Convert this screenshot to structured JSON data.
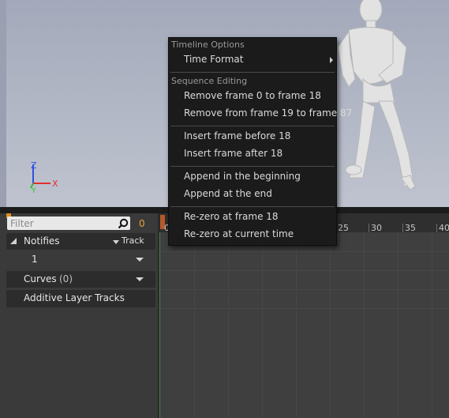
{
  "viewport": {
    "axis": {
      "z": "Z",
      "x": "X",
      "y": "Y"
    }
  },
  "timeline": {
    "filter_placeholder": "Filter",
    "frame_count": "0",
    "ruler_ticks": [
      "0",
      "25",
      "30",
      "35",
      "40"
    ],
    "notifies": {
      "label": "Notifies",
      "track_button": "Track",
      "track_index": "1"
    },
    "curves": {
      "label": "Curves",
      "count": "(0)"
    },
    "additive": {
      "label": "Additive Layer Tracks"
    }
  },
  "menu": {
    "section_timeline": "Timeline Options",
    "time_format": "Time Format",
    "section_sequence": "Sequence Editing",
    "remove_0_18": "Remove frame 0 to frame 18",
    "remove_19_87": "Remove from frame 19 to frame 87",
    "insert_before": "Insert frame before 18",
    "insert_after": "Insert frame after 18",
    "append_begin": "Append in the beginning",
    "append_end": "Append at the end",
    "rezero_frame": "Re-zero at frame 18",
    "rezero_current": "Re-zero at current time"
  },
  "colors": {
    "accent_orange": "#e8a33a",
    "axis_x": "#e03030",
    "axis_y": "#30c030",
    "axis_z": "#3050e0"
  }
}
